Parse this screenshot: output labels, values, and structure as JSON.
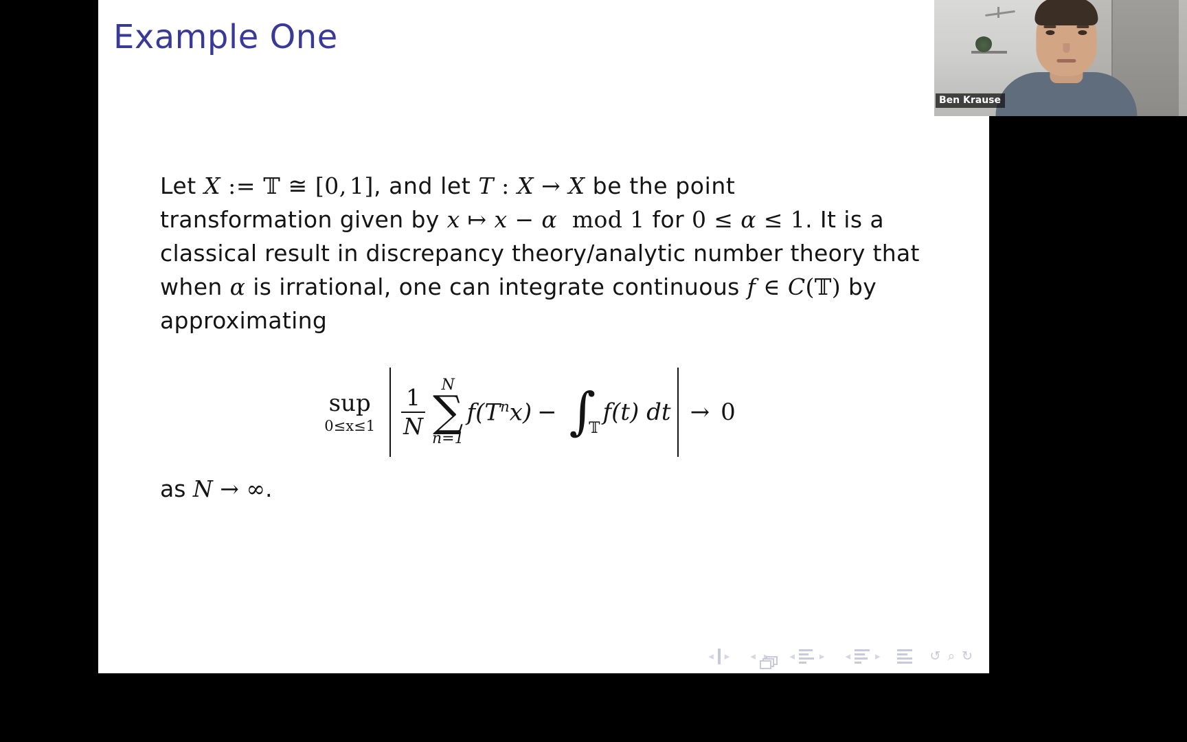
{
  "slide": {
    "title": "Example One",
    "paragraph_lines": [
      "Let X := T ≅ [0, 1], and let T : X → X be the point",
      "transformation given by x ↦ x − α   mod 1 for 0 ≤ α ≤ 1. It is a",
      "classical result in discrepancy theory/analytic number theory that",
      "when α is irrational, one can integrate continuous f ∈ C(T) by",
      "approximating"
    ],
    "paragraph_plain": "Let X := T ≅ [0,1], and let T : X → X be the point transformation given by x ↦ x − α mod 1 for 0 ≤ α ≤ 1. It is a classical result in discrepancy theory/analytic number theory that when α is irrational, one can integrate continuous f ∈ C(T) by approximating",
    "equation": {
      "sup_label": "sup",
      "sup_subscript": "0≤x≤1",
      "fraction_numerator": "1",
      "fraction_denominator": "N",
      "sum_glyph": "∑",
      "sum_upper": "N",
      "sum_lower": "n=1",
      "summand": "f(Tⁿx)",
      "minus": "−",
      "integral_glyph": "∫",
      "integral_subscript": "𝕋",
      "integrand": "f(t) dt",
      "arrow": "→",
      "limit_value": "0",
      "plain": "sup_{0≤x≤1} | (1/N) ∑_{n=1}^{N} f(Tⁿx) − ∫_𝕋 f(t) dt | → 0"
    },
    "closing_line": "as N → ∞.",
    "title_color": "#393999",
    "text_color": "#141414",
    "background_color": "#ffffff"
  },
  "navbar": {
    "groups": [
      {
        "icon": "slide-icon",
        "prev": "◂",
        "next": "▸"
      },
      {
        "icon": "frame-stack-icon",
        "prev": "◂",
        "next": "▸"
      },
      {
        "icon": "section-icon",
        "prev": "◂",
        "next": "▸"
      },
      {
        "icon": "subsection-icon",
        "prev": "◂",
        "next": "▸"
      }
    ],
    "doc_icon": "document-icon",
    "extra_icons": [
      "back-icon",
      "search-icon",
      "forward-icon"
    ],
    "back_glyph": "↺",
    "search_glyph": "⌕",
    "forward_glyph": "↻",
    "color": "#c9c9dd"
  },
  "webcam": {
    "presenter_name": "Ben Krause"
  },
  "letterbox": {
    "color": "#000000"
  }
}
